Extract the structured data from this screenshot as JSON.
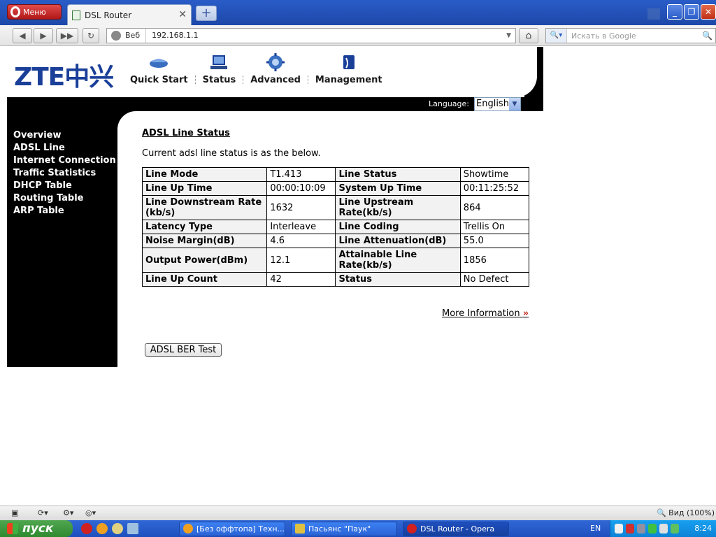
{
  "browser": {
    "menu_label": "Меню",
    "tab_title": "DSL Router",
    "tab_close": "✕",
    "new_tab": "+",
    "url_mode": "Веб",
    "url": "192.168.1.1",
    "search_placeholder": "Искать в Google",
    "zoom_label": "Вид (100%)"
  },
  "router": {
    "logo": "ZTE中兴",
    "nav": [
      {
        "label": "Quick Start"
      },
      {
        "label": "Status"
      },
      {
        "label": "Advanced"
      },
      {
        "label": "Management"
      }
    ],
    "language_label": "Language:",
    "language_value": "English",
    "sidebar": [
      "Overview",
      "ADSL Line",
      "Internet Connection",
      "Traffic Statistics",
      "DHCP Table",
      "Routing Table",
      "ARP Table"
    ],
    "title": "ADSL Line Status",
    "description": "Current adsl line status is as the below.",
    "table": [
      [
        "Line Mode",
        "T1.413",
        "Line Status",
        "Showtime"
      ],
      [
        "Line Up Time",
        "00:00:10:09",
        "System Up Time",
        "00:11:25:52"
      ],
      [
        "Line Downstream Rate (kb/s)",
        "1632",
        "Line Upstream Rate(kb/s)",
        "864"
      ],
      [
        "Latency Type",
        "Interleave",
        "Line Coding",
        "Trellis On"
      ],
      [
        "Noise Margin(dB)",
        "4.6",
        "Line Attenuation(dB)",
        "55.0"
      ],
      [
        "Output Power(dBm)",
        "12.1",
        "Attainable Line Rate(kb/s)",
        "1856"
      ],
      [
        "Line Up Count",
        "42",
        "Status",
        "No Defect"
      ]
    ],
    "more_info": "More Information",
    "ber_button": "ADSL BER Test"
  },
  "taskbar": {
    "start": "пуск",
    "tasks": [
      "[Без оффтопа] Техн...",
      "Пасьянс \"Паук\"",
      "DSL Router - Opera"
    ],
    "language": "EN",
    "clock": "8:24"
  }
}
